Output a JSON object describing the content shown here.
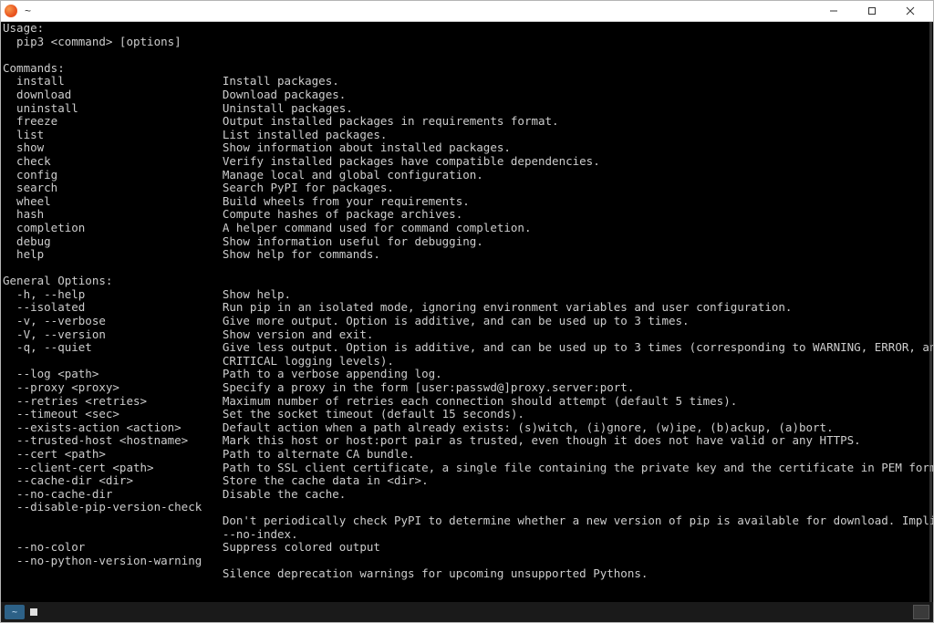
{
  "window": {
    "title": "~"
  },
  "usage": {
    "heading": "Usage:",
    "line": "  pip3 <command> [options]"
  },
  "commands_heading": "Commands:",
  "commands": [
    {
      "name": "install",
      "desc": "Install packages."
    },
    {
      "name": "download",
      "desc": "Download packages."
    },
    {
      "name": "uninstall",
      "desc": "Uninstall packages."
    },
    {
      "name": "freeze",
      "desc": "Output installed packages in requirements format."
    },
    {
      "name": "list",
      "desc": "List installed packages."
    },
    {
      "name": "show",
      "desc": "Show information about installed packages."
    },
    {
      "name": "check",
      "desc": "Verify installed packages have compatible dependencies."
    },
    {
      "name": "config",
      "desc": "Manage local and global configuration."
    },
    {
      "name": "search",
      "desc": "Search PyPI for packages."
    },
    {
      "name": "wheel",
      "desc": "Build wheels from your requirements."
    },
    {
      "name": "hash",
      "desc": "Compute hashes of package archives."
    },
    {
      "name": "completion",
      "desc": "A helper command used for command completion."
    },
    {
      "name": "debug",
      "desc": "Show information useful for debugging."
    },
    {
      "name": "help",
      "desc": "Show help for commands."
    }
  ],
  "options_heading": "General Options:",
  "options": [
    {
      "flag": "-h, --help",
      "desc": "Show help."
    },
    {
      "flag": "--isolated",
      "desc": "Run pip in an isolated mode, ignoring environment variables and user configuration."
    },
    {
      "flag": "-v, --verbose",
      "desc": "Give more output. Option is additive, and can be used up to 3 times."
    },
    {
      "flag": "-V, --version",
      "desc": "Show version and exit."
    },
    {
      "flag": "-q, --quiet",
      "desc": "Give less output. Option is additive, and can be used up to 3 times (corresponding to WARNING, ERROR, and",
      "cont": [
        "CRITICAL logging levels)."
      ]
    },
    {
      "flag": "--log <path>",
      "desc": "Path to a verbose appending log."
    },
    {
      "flag": "--proxy <proxy>",
      "desc": "Specify a proxy in the form [user:passwd@]proxy.server:port."
    },
    {
      "flag": "--retries <retries>",
      "desc": "Maximum number of retries each connection should attempt (default 5 times)."
    },
    {
      "flag": "--timeout <sec>",
      "desc": "Set the socket timeout (default 15 seconds)."
    },
    {
      "flag": "--exists-action <action>",
      "desc": "Default action when a path already exists: (s)witch, (i)gnore, (w)ipe, (b)ackup, (a)bort."
    },
    {
      "flag": "--trusted-host <hostname>",
      "desc": "Mark this host or host:port pair as trusted, even though it does not have valid or any HTTPS."
    },
    {
      "flag": "--cert <path>",
      "desc": "Path to alternate CA bundle."
    },
    {
      "flag": "--client-cert <path>",
      "desc": "Path to SSL client certificate, a single file containing the private key and the certificate in PEM format."
    },
    {
      "flag": "--cache-dir <dir>",
      "desc": "Store the cache data in <dir>."
    },
    {
      "flag": "--no-cache-dir",
      "desc": "Disable the cache."
    },
    {
      "flag": "--disable-pip-version-check",
      "desc": "",
      "cont": [
        "Don't periodically check PyPI to determine whether a new version of pip is available for download. Implied with",
        "--no-index."
      ]
    },
    {
      "flag": "--no-color",
      "desc": "Suppress colored output"
    },
    {
      "flag": "--no-python-version-warning",
      "desc": "",
      "cont": [
        "Silence deprecation warnings for upcoming unsupported Pythons."
      ]
    }
  ],
  "prompt": {
    "symbol": "~",
    "input": ""
  },
  "layout": {
    "indent": "  ",
    "desc_col": 32
  }
}
